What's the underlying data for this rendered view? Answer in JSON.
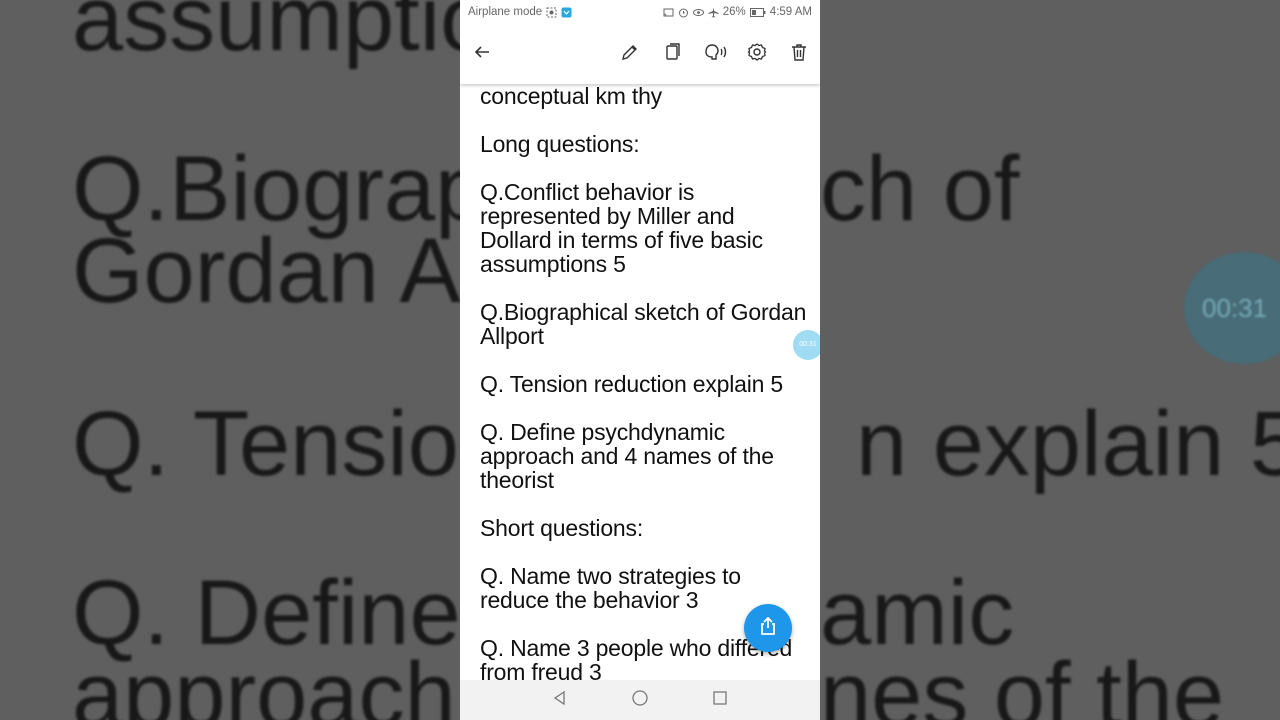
{
  "background": {
    "lines": [
      "assumptio",
      "Q.Biograph",
      "Gordan All",
      "Q. Tension",
      "Q. Define p",
      "approach a"
    ],
    "right_lines": [
      "ch of",
      "n explain 5",
      "amic",
      "nes of the"
    ],
    "timer": "00:31"
  },
  "status_bar": {
    "left_text": "Airplane mode",
    "battery": "26%",
    "time": "4:59 AM"
  },
  "toolbar": {
    "icons": [
      "back-arrow-icon",
      "pencil-icon",
      "copy-icon",
      "speaker-icon",
      "gear-icon",
      "trash-icon"
    ]
  },
  "note": {
    "paragraphs": [
      "conceptual km thy",
      "Long questions:",
      "Q.Conflict behavior is represented by Miller and Dollard in terms of five basic assumptions 5",
      "Q.Biographical sketch of Gordan Allport",
      "Q. Tension reduction explain 5",
      "Q. Define psychdynamic approach and 4 names of the theorist",
      "Short questions:",
      "Q. Name two strategies to reduce the behavior 3",
      "Q. Name 3 people who differed from freud 3"
    ]
  },
  "timer_bubble": "00:31",
  "colors": {
    "fab": "#1e96ea",
    "timer_bubble": "#9fdcf4",
    "background": "#5f5f5f"
  }
}
